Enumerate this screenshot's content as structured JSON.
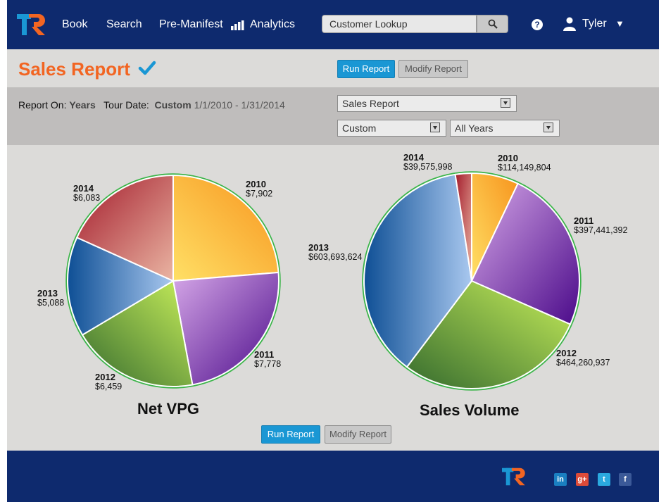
{
  "header": {
    "logo_text": "TR",
    "nav": [
      "Book",
      "Search",
      "Pre-Manifest",
      "Analytics"
    ],
    "search_placeholder": "Customer Lookup",
    "help": "?",
    "user_name": "Tyler",
    "caret": "▼"
  },
  "page": {
    "title": "Sales Report"
  },
  "buttons": {
    "run": "Run Report",
    "modify": "Modify Report"
  },
  "filters": {
    "report_on_label": "Report On:",
    "report_on_value": "Years",
    "tour_date_label": "Tour Date:",
    "tour_date_value": "Custom",
    "date_range": "1/1/2010 - 1/31/2014",
    "report_select": "Sales Report",
    "date_select": "Custom",
    "years_select": "All Years"
  },
  "chart_data": [
    {
      "type": "pie",
      "title": "Net VPG",
      "categories": [
        "2010",
        "2011",
        "2012",
        "2013",
        "2014"
      ],
      "values": [
        7902,
        7778,
        6459,
        5088,
        6083
      ],
      "labels": [
        "$7,902",
        "$7,778",
        "$6,459",
        "$5,088",
        "$6,083"
      ]
    },
    {
      "type": "pie",
      "title": "Sales Volume",
      "categories": [
        "2010",
        "2011",
        "2012",
        "2013",
        "2014"
      ],
      "values": [
        114149804,
        397441392,
        464260937,
        603693624,
        39575998
      ],
      "labels": [
        "$114,149,804",
        "$397,441,392",
        "$464,260,937",
        "$603,693,624",
        "$39,575,998"
      ]
    }
  ],
  "colors": {
    "header_bg": "#0e2a6e",
    "title_orange": "#f26522",
    "run_button": "#1a97d4",
    "check": "#1a97d4"
  },
  "footer": {
    "logo_text": "TR",
    "social": [
      {
        "name": "linkedin",
        "glyph": "in",
        "color": "#1a7fc1"
      },
      {
        "name": "google-plus",
        "glyph": "g+",
        "color": "#dd4b39"
      },
      {
        "name": "twitter",
        "glyph": "t",
        "color": "#2aa9e0"
      },
      {
        "name": "facebook",
        "glyph": "f",
        "color": "#3b5998"
      }
    ]
  }
}
